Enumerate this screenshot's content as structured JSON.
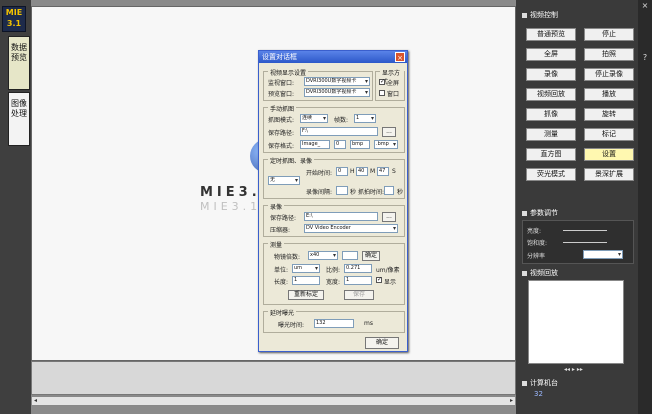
{
  "app": {
    "logo": "MIE 3.1",
    "brand": "MIE3.1",
    "tabs": [
      "数据预览",
      "图像处理"
    ]
  },
  "dialog": {
    "title": "设置对话框",
    "view_group": {
      "title": "视频显示设置",
      "label1": "监视窗口:",
      "value1": "DVRI300U数字视频卡",
      "label2": "预览窗口:",
      "value2": "DVRI300U数字视频卡"
    },
    "display_group": {
      "title": "显示方式",
      "opt1": "全屏",
      "opt2": "窗口"
    },
    "manual_group": {
      "title": "手动抓图",
      "mode_label": "抓图模式:",
      "mode_value": "连续",
      "count_label": "帧数:",
      "count_value": "1",
      "path_label": "保存路径:",
      "path_value": "F:\\",
      "browse": "...",
      "format_label": "保存格式:",
      "prefix": "Image_",
      "num": "0",
      "num2": "bmp",
      "ext": ".bmp"
    },
    "timer_group": {
      "title": "定时抓图、录像",
      "mode": "无",
      "interval_label": "开始时间:",
      "h": "0",
      "m": "40",
      "s": "47",
      "unit_h": "H",
      "unit_m": "M",
      "unit_s": "S",
      "rec_label": "录像间隔:",
      "rec_value": "",
      "rec_unit": "秒",
      "count_label": "抓拍时间:",
      "count_value": "",
      "count_unit": "秒"
    },
    "record_group": {
      "title": "录像",
      "path_label": "保存路径:",
      "path_value": "E:\\",
      "browse": "...",
      "codec_label": "压缩器:",
      "codec_value": "DV Video Encoder"
    },
    "measure_group": {
      "title": "测量",
      "zoom_label": "物镜倍数:",
      "zoom_value": "x40",
      "apply": "确定",
      "unit_label": "单位:",
      "unit_value": "um",
      "pixel_label": "比例:",
      "pixel_value": "0.271",
      "unit_suffix": "um/像素",
      "len_label": "长度:",
      "len_value": "1",
      "width_label": "宽度:",
      "width_value": "1",
      "check": "显示",
      "calib": "重新标定",
      "save": "保存"
    },
    "delay_group": {
      "title": "延时曝光",
      "label": "曝光时间:",
      "value": "132",
      "unit": "ms"
    },
    "ok": "确定"
  },
  "right_panel": {
    "video_title": "视频控制",
    "buttons": [
      [
        "普通预览",
        "停止"
      ],
      [
        "全屏",
        "拍照"
      ],
      [
        "录像",
        "停止录像"
      ],
      [
        "视频回放",
        "播放"
      ],
      [
        "抓像",
        "旋转"
      ],
      [
        "测量",
        "标记"
      ],
      [
        "直方图",
        "设置"
      ],
      [
        "荧光模式",
        "景深扩展"
      ]
    ],
    "param_title": "参数调节",
    "sliders": [
      "亮度:",
      "饱和度:",
      "分辨率"
    ],
    "preview_title": "视频回放",
    "count_title": "计算机台",
    "count_value": "32"
  },
  "far_right": [
    "×",
    "?"
  ]
}
